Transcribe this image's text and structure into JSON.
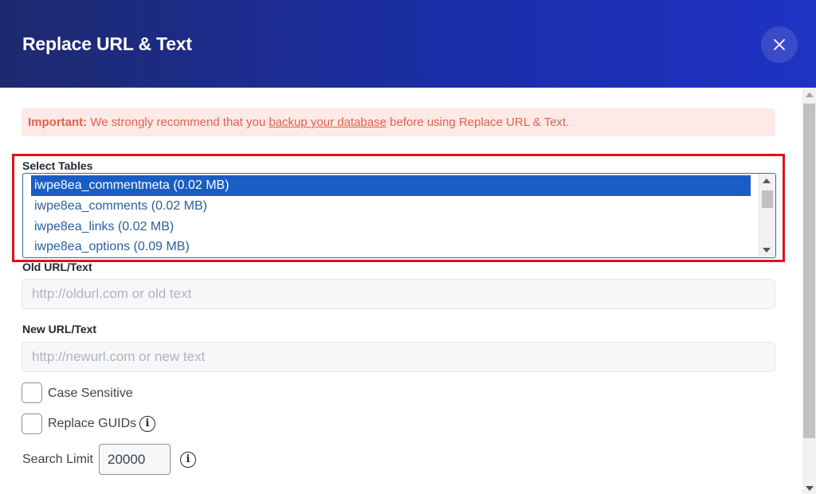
{
  "dialog": {
    "title": "Replace URL & Text",
    "close_icon": "close-icon"
  },
  "notice": {
    "strong": "Important:",
    "text_before": "We strongly recommend that you",
    "link": "backup your database",
    "text_after": "before using Replace URL & Text."
  },
  "tables": {
    "label": "Select Tables",
    "options": [
      {
        "label": "iwpe8ea_commentmeta (0.02 MB)",
        "selected": true
      },
      {
        "label": "iwpe8ea_comments (0.02 MB)",
        "selected": false
      },
      {
        "label": "iwpe8ea_links (0.02 MB)",
        "selected": false
      },
      {
        "label": "iwpe8ea_options (0.09 MB)",
        "selected": false
      }
    ]
  },
  "old_url": {
    "label": "Old URL/Text",
    "placeholder": "http://oldurl.com or old text",
    "value": ""
  },
  "new_url": {
    "label": "New URL/Text",
    "placeholder": "http://newurl.com or new text",
    "value": ""
  },
  "case_sensitive": {
    "label": "Case Sensitive",
    "checked": false
  },
  "replace_guids": {
    "label": "Replace GUIDs",
    "checked": false,
    "info_icon": "info-icon"
  },
  "search_limit": {
    "label": "Search Limit",
    "value": "20000",
    "info_icon": "info-icon"
  },
  "colors": {
    "header_gradient_start": "#1e2a6e",
    "header_gradient_end": "#1f33c4",
    "notice_bg": "#fde9e6",
    "notice_text": "#e0624d",
    "selected_option": "#1a5ec5",
    "highlight_border": "#e0101e"
  }
}
